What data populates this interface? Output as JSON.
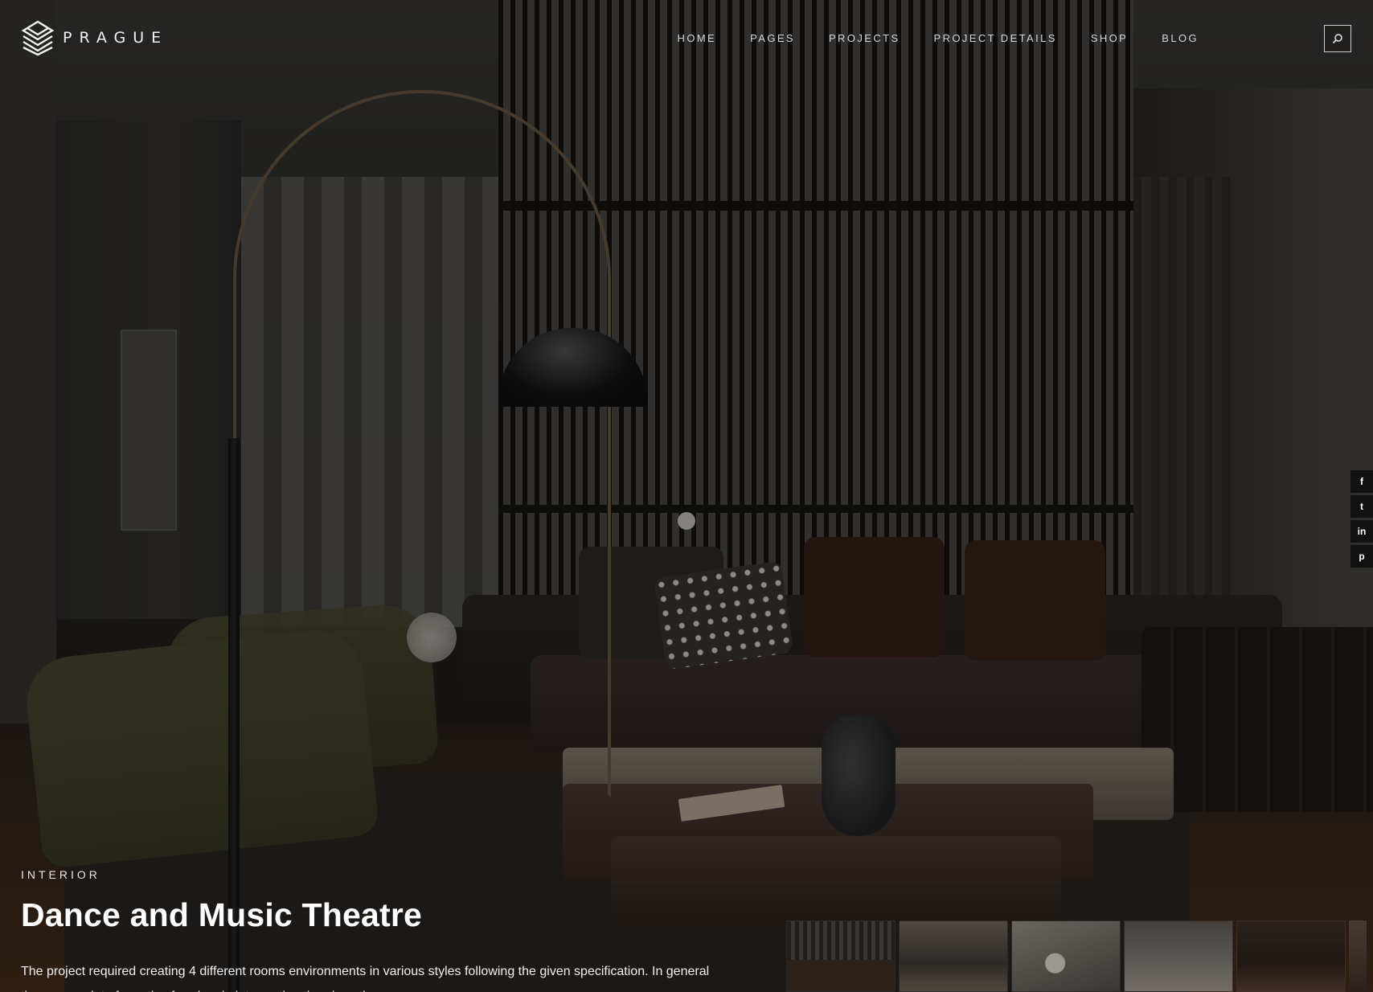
{
  "brand": {
    "name": "PRAGUE",
    "logo_icon": "stacked-diamond-logo-icon"
  },
  "nav": {
    "items": [
      {
        "label": "HOME"
      },
      {
        "label": "PAGES"
      },
      {
        "label": "PROJECTS"
      },
      {
        "label": "PROJECT DETAILS"
      },
      {
        "label": "SHOP"
      },
      {
        "label": "BLOG"
      }
    ],
    "search_icon": "search-icon"
  },
  "social": {
    "items": [
      {
        "icon": "facebook-icon",
        "glyph": "f"
      },
      {
        "icon": "twitter-icon",
        "glyph": "t"
      },
      {
        "icon": "linkedin-icon",
        "glyph": "in"
      },
      {
        "icon": "pinterest-icon",
        "glyph": "p"
      }
    ]
  },
  "hero": {
    "category": "INTERIOR",
    "title": "Dance and Music Theatre",
    "description": "The project required creating 4 different rooms environments in various styles following the given specification. In general there was a lot of creative freedom in interpreting the given themes."
  },
  "gallery": {
    "thumbnails": [
      {
        "label": ""
      },
      {
        "label": ""
      },
      {
        "label": ""
      },
      {
        "label": ""
      },
      {
        "label": ""
      }
    ]
  },
  "colors": {
    "overlay": "#000000",
    "text": "#ffffff",
    "nav_text": "#d7d7d7"
  }
}
